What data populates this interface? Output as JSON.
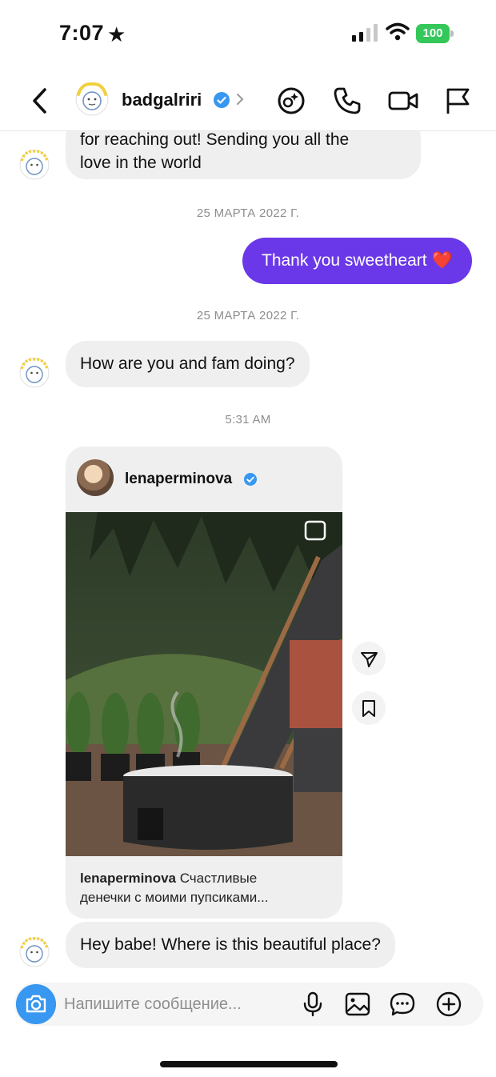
{
  "status_bar": {
    "time": "7:07",
    "battery": "100"
  },
  "header": {
    "username": "badgalriri"
  },
  "messages": {
    "m1_line1": "for reaching out! Sending you all the",
    "m1_line2": "love in the world",
    "date1": "25 МАРТА 2022 Г.",
    "m2": "Thank you sweetheart ❤️",
    "date2": "25 МАРТА 2022 Г.",
    "m3": "How are you and fam doing?",
    "time3": "5:31 AM",
    "m4": "Hey babe! Where is this beautiful place?"
  },
  "post": {
    "username": "lenaperminova",
    "caption_user": "lenaperminova",
    "caption_line1": " Счастливые",
    "caption_line2": "денечки с моими пупсиками..."
  },
  "composer": {
    "placeholder": "Напишите сообщение..."
  },
  "colors": {
    "outgoing_bubble": "#6a38e8",
    "camera_button": "#3897f0",
    "verified": "#3897f0",
    "battery": "#34c759"
  }
}
